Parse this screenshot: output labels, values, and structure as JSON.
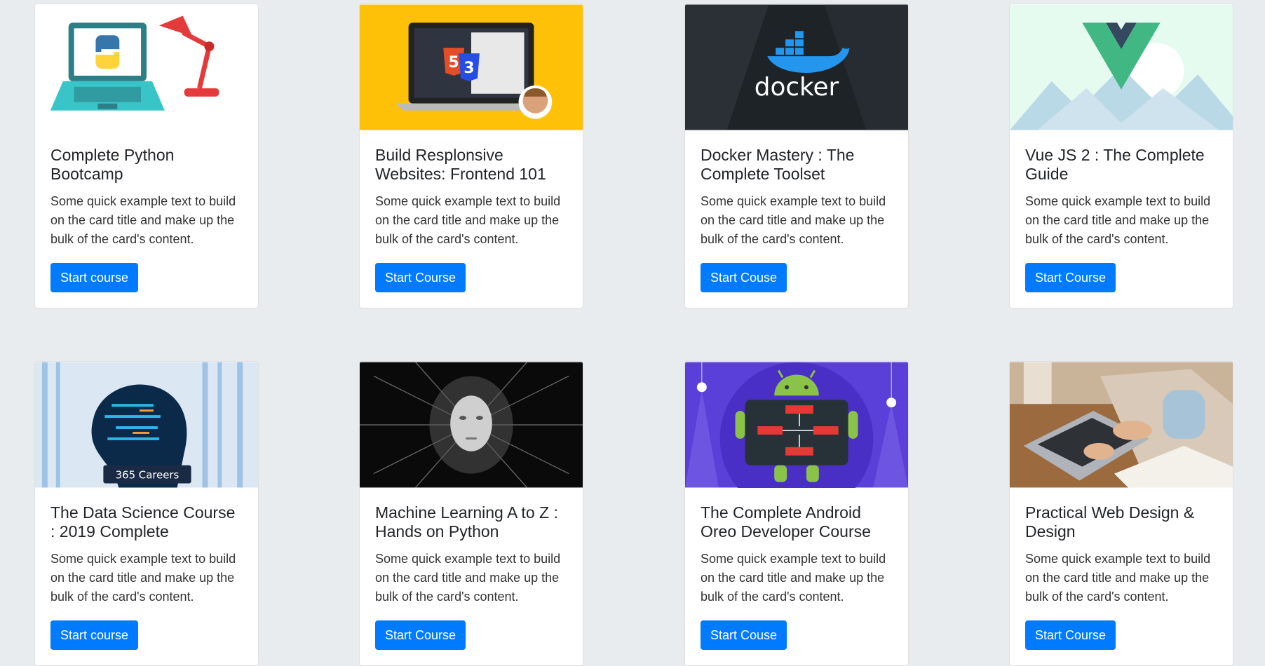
{
  "cards": [
    {
      "title": "Complete Python Bootcamp",
      "text": "Some quick example text to build on the card title and make up the bulk of the card's content.",
      "button": "Start course",
      "image_icon": "python-laptop-lamp-image"
    },
    {
      "title": "Build Resplonsive Websites: Frontend 101",
      "text": "Some quick example text to build on the card title and make up the bulk of the card's content.",
      "button": "Start Course",
      "image_icon": "html5-css3-laptop-image"
    },
    {
      "title": "Docker Mastery : The Complete Toolset",
      "text": "Some quick example text to build on the card title and make up the bulk of the card's content.",
      "button": "Start Couse",
      "image_icon": "docker-whale-image",
      "image_label": "docker"
    },
    {
      "title": "Vue JS 2 : The Complete Guide",
      "text": "Some quick example text to build on the card title and make up the bulk of the card's content.",
      "button": "Start Course",
      "image_icon": "vue-logo-mountains-image"
    },
    {
      "title": "The Data Science Course : 2019 Complete",
      "text": "Some quick example text to build on the card title and make up the bulk of the card's content.",
      "button": "Start course",
      "image_icon": "data-head-image",
      "image_label": "365 Careers"
    },
    {
      "title": "Machine Learning A to Z : Hands on Python",
      "text": "Some quick example text to build on the card title and make up the bulk of the card's content.",
      "button": "Start Course",
      "image_icon": "ai-face-image"
    },
    {
      "title": "The Complete Android Oreo Developer Course",
      "text": "Some quick example text to build on the card title and make up the bulk of the card's content.",
      "button": "Start Couse",
      "image_icon": "android-robot-image"
    },
    {
      "title": "Practical Web Design & Design",
      "text": "Some quick example text to build on the card title and make up the bulk of the card's content.",
      "button": "Start Course",
      "image_icon": "laptop-typing-image"
    }
  ],
  "colors": {
    "page_bg": "#e9ecef",
    "card_bg": "#ffffff",
    "button_bg": "#007bff",
    "button_text": "#ffffff"
  }
}
